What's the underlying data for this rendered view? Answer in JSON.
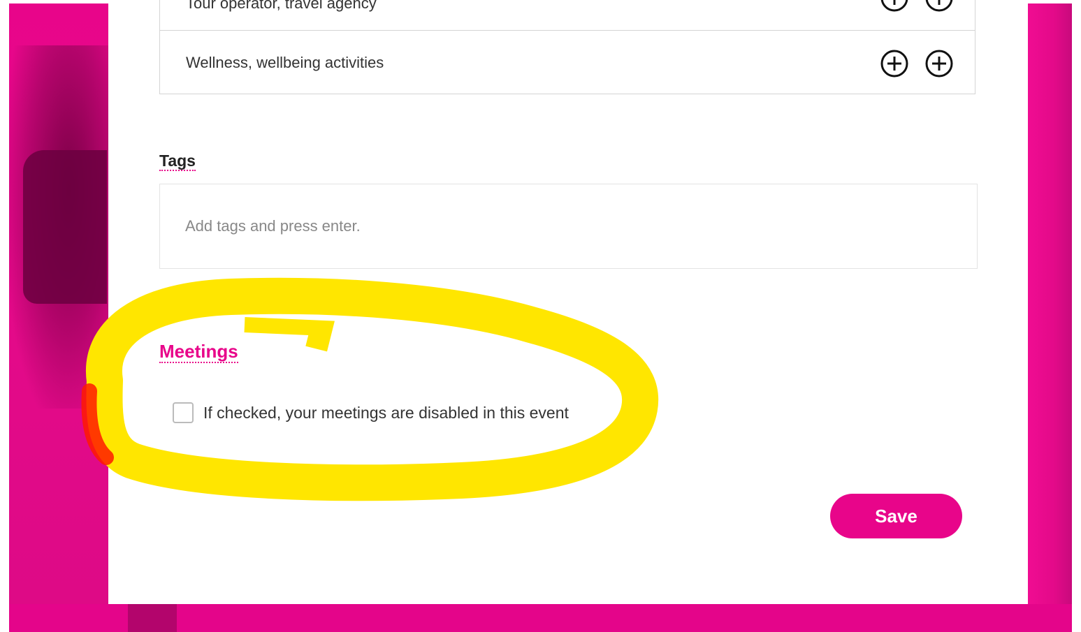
{
  "colors": {
    "brand": "#e8058a",
    "annotation": "#ffe600",
    "panel": "#ffffff"
  },
  "categories": {
    "items": [
      {
        "label": "Tour operator, travel agency"
      },
      {
        "label": "Wellness, wellbeing activities"
      }
    ]
  },
  "tags": {
    "label": "Tags",
    "placeholder": "Add tags and press enter.",
    "value": ""
  },
  "meetings": {
    "label": "Meetings",
    "checkbox_label": "If checked, your meetings are disabled in this event",
    "checked": false
  },
  "actions": {
    "save_label": "Save"
  }
}
